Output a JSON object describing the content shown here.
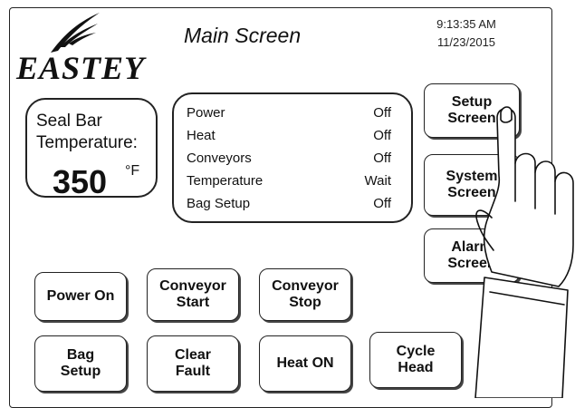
{
  "header": {
    "logo_text": "EASTEY",
    "title": "Main Screen",
    "time": "9:13:35 AM",
    "date": "11/23/2015"
  },
  "temperature": {
    "label": "Seal Bar\nTemperature:",
    "value": "350",
    "unit": "°F"
  },
  "status": [
    {
      "key": "Power",
      "value": "Off"
    },
    {
      "key": "Heat",
      "value": "Off"
    },
    {
      "key": "Conveyors",
      "value": "Off"
    },
    {
      "key": "Temperature",
      "value": "Wait"
    },
    {
      "key": "Bag Setup",
      "value": "Off"
    }
  ],
  "nav": {
    "setup": "Setup\nScreen",
    "system": "System\nScreen",
    "alarm": "Alarm\nScreen"
  },
  "controls": {
    "power_on": "Power On",
    "conveyor_start": "Conveyor\nStart",
    "conveyor_stop": "Conveyor\nStop",
    "bag_setup": "Bag\nSetup",
    "clear_fault": "Clear\nFault",
    "heat_on": "Heat ON",
    "cycle_head": "Cycle\nHead"
  },
  "icons": {
    "logo_mark": "feather-swoosh-icon",
    "pointer": "pointing-hand-icon"
  }
}
